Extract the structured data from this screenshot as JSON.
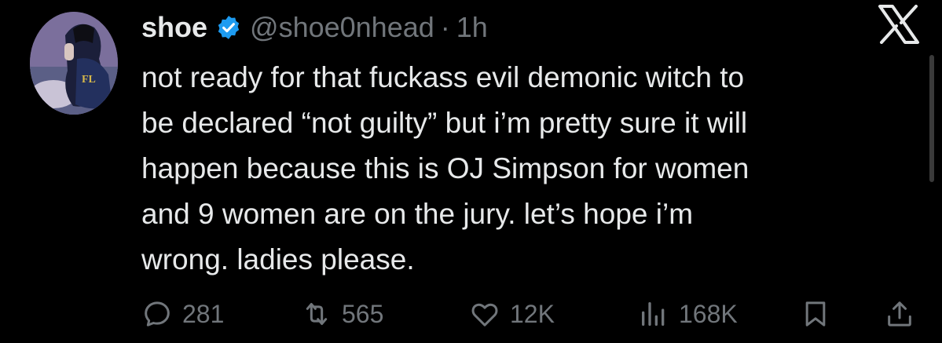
{
  "author": {
    "display_name": "shoe",
    "handle": "@shoe0nhead",
    "separator": "·",
    "time": "1h",
    "avatar_text": "FL"
  },
  "tweet": {
    "lines": [
      "not ready for that fuckass evil demonic witch to",
      "be declared “not guilty” but i’m pretty sure it will",
      "happen because this is OJ Simpson for women",
      "and 9 women are on the jury. let’s hope i’m",
      "wrong. ladies please."
    ]
  },
  "metrics": {
    "replies": "281",
    "reposts": "565",
    "likes": "12K",
    "views": "168K"
  },
  "icons": {
    "verified": "verified-badge-icon",
    "platform": "x-logo-icon",
    "reply": "reply-icon",
    "repost": "repost-icon",
    "like": "heart-icon",
    "views": "views-icon",
    "bookmark": "bookmark-icon",
    "share": "share-icon"
  },
  "colors": {
    "background": "#000000",
    "text": "#e7e9ea",
    "muted": "#71767b",
    "verified": "#1d9bf0"
  }
}
